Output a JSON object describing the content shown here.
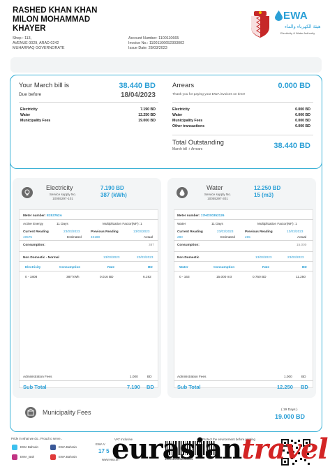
{
  "customer": {
    "name_line1": "RASHED KHAN KHAN",
    "name_line2": "MILON MOHAMMAD",
    "name_line3": "KHAYER",
    "address_line1": "Shop : 113,",
    "address_line2": "AVENUE 0029, ARAD 0242",
    "address_line3": "MUHARRAQ GOVERNORATE"
  },
  "account": {
    "account_number": "Account Number: 1100110665",
    "invoice_no": "Invoice No.: 11001106652303002",
    "issue_date": "Issue Date: 28/03/2023"
  },
  "logo": {
    "brand": "EWA",
    "arabic": "هيئة الكهرباء والماء",
    "english": "Electricity & Water Authority"
  },
  "bill": {
    "title": "Your March bill is",
    "amount": "38.440 BD",
    "due_label": "Due before",
    "due_date": "18/04/2023",
    "lines": [
      {
        "label": "Electricity",
        "value": "7.190 BD"
      },
      {
        "label": "Water",
        "value": "12.250 BD"
      },
      {
        "label": "Municipality Fees",
        "value": "19.000 BD"
      }
    ]
  },
  "arrears": {
    "title": "Arrears",
    "amount": "0.000 BD",
    "thanks": "Thank you for paying your EWA invoices on time!",
    "lines": [
      {
        "label": "Electricity",
        "value": "0.000 BD"
      },
      {
        "label": "Water",
        "value": "0.000 BD"
      },
      {
        "label": "Municipality Fees",
        "value": "0.000 BD"
      },
      {
        "label": "Other transactions",
        "value": "0.000 BD"
      }
    ],
    "total_title": "Total Outstanding",
    "total_sub": "March bill + Arrears",
    "total_amount": "38.440 BD"
  },
  "electricity": {
    "name": "Electricity",
    "supply_label": "Service supply No.",
    "supply_no": "10055297-101",
    "amount": "7.190 BD",
    "usage": "387 (kWh)",
    "meter_label": "Meter number:",
    "meter_no": "E253762A",
    "energy_label": "Active Energy",
    "days": "11 Days",
    "factor": "Multiplication Factor(MF): 1",
    "current_label": "Current Reading",
    "current_date": "23/03/2023",
    "current_value": "40575",
    "current_type": "Estimated",
    "previous_label": "Previous Reading",
    "previous_date": "13/03/2023",
    "previous_value": "40188",
    "previous_type": "Actual",
    "consumption_label": "Consumption:",
    "consumption": "387",
    "tariff": "Non Domestic - Normal",
    "tariff_from": "13/03/2023",
    "tariff_to": "23/03/2023",
    "headers": [
      "Electricity",
      "Consumption",
      "Rate",
      "BD"
    ],
    "row": [
      "0 - 1808",
      "387 kWh",
      "0.016 BD",
      "6.192"
    ],
    "admin_label": "Administration Fees",
    "admin_value": "1.000",
    "admin_unit": "BD",
    "subtotal_label": "Sub Total",
    "subtotal_value": "7.190",
    "subtotal_unit": "BD"
  },
  "water": {
    "name": "Water",
    "supply_label": "Service supply No.",
    "supply_no": "10055297-301",
    "amount": "12.250 BD",
    "usage": "15 (m3)",
    "meter_label": "Meter number:",
    "meter_no": "17HOS0352126",
    "energy_label": "Water",
    "days": "11 Days",
    "factor": "Multiplication Factor(MF): 1",
    "current_label": "Current Reading",
    "current_date": "23/03/2023",
    "current_value": "280",
    "current_type": "Estimated",
    "previous_label": "Previous Reading",
    "previous_date": "13/03/2023",
    "previous_value": "265",
    "previous_type": "Actual",
    "consumption_label": "Consumption:",
    "consumption": "15.000",
    "tariff": "Non Domestic",
    "tariff_from": "13/03/2023",
    "tariff_to": "23/03/2023",
    "headers": [
      "Water",
      "Consumption",
      "Rate",
      "BD"
    ],
    "row": [
      "0 - 163",
      "15.000 m3",
      "0.750 BD",
      "11.250"
    ],
    "admin_label": "Administration Fees",
    "admin_value": "1.000",
    "admin_unit": "BD",
    "subtotal_label": "Sub Total",
    "subtotal_value": "12.250",
    "subtotal_unit": "BD"
  },
  "municipality": {
    "label": "Municipality Fees",
    "days": "( 19 Days )",
    "amount": "19.000 BD"
  },
  "footer": {
    "proud": "Pride in what we do.. Proud to serve..",
    "social": [
      "EWA Bahrain",
      "EWA Bahrain",
      "EWA_Bah",
      "EWA Bahrain"
    ],
    "vat": "VAT Inclusive",
    "website": "www.ewa.bh",
    "phone_partial": "17 5",
    "ewa_partial": "EWA V",
    "invoice_no": "11001106652303002",
    "protect": "Protect the environment before printing"
  },
  "watermark": {
    "black": "eurasian",
    "red": "travel"
  }
}
